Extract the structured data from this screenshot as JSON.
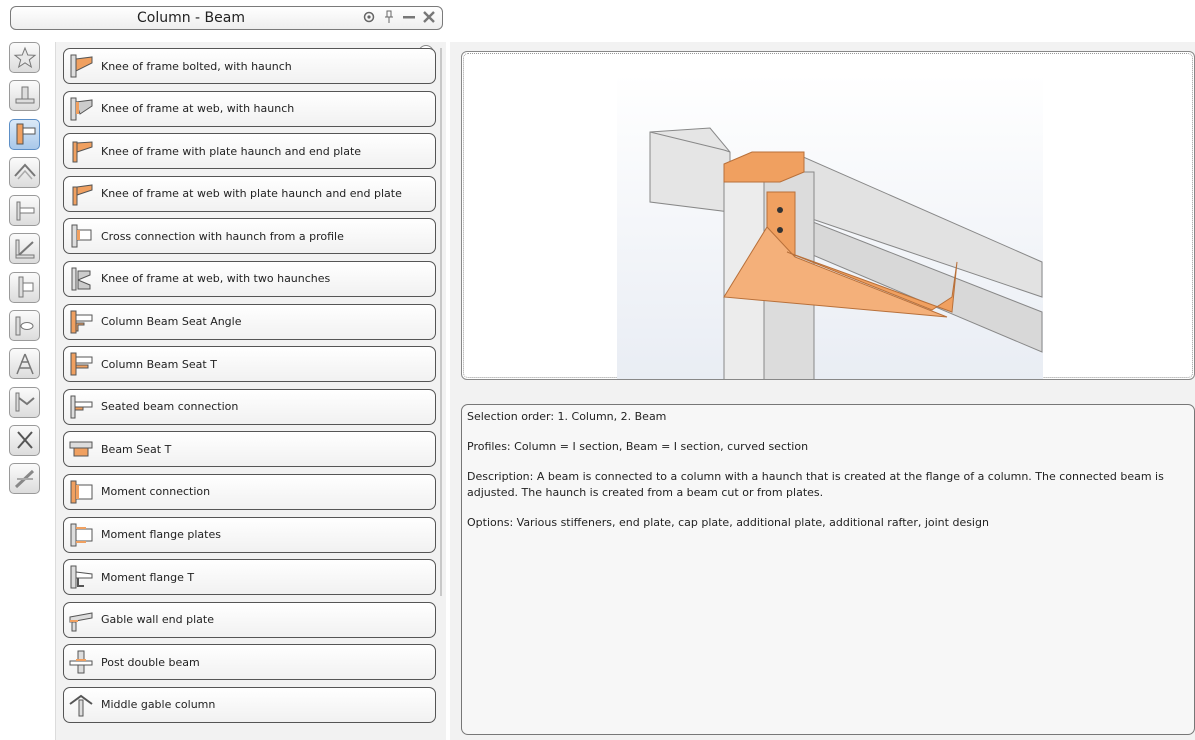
{
  "window": {
    "title": "Column - Beam"
  },
  "titlebar_icons": [
    "settings-icon",
    "pin-icon",
    "minimize-icon",
    "close-icon"
  ],
  "sidebar": {
    "buttons": [
      {
        "icon": "favorites-star-icon",
        "active": false
      },
      {
        "icon": "base-plate-icon",
        "active": false
      },
      {
        "icon": "column-beam-icon",
        "active": true
      },
      {
        "icon": "ridge-icon",
        "active": false
      },
      {
        "icon": "beam-beam-icon",
        "active": false
      },
      {
        "icon": "bracing-icon",
        "active": false
      },
      {
        "icon": "column-splice-icon",
        "active": false
      },
      {
        "icon": "pipe-connection-icon",
        "active": false
      },
      {
        "icon": "tower-icon",
        "active": false
      },
      {
        "icon": "frame-icon",
        "active": false
      },
      {
        "icon": "stairs-icon",
        "active": false
      },
      {
        "icon": "misc-icon",
        "active": false
      }
    ]
  },
  "connections": [
    {
      "label": "Knee of frame bolted, with haunch"
    },
    {
      "label": "Knee of frame at web, with haunch"
    },
    {
      "label": "Knee of frame with plate haunch and end plate"
    },
    {
      "label": "Knee of frame at web with plate haunch and end plate"
    },
    {
      "label": "Cross connection with haunch from a profile"
    },
    {
      "label": "Knee of frame at web, with two haunches"
    },
    {
      "label": "Column Beam Seat Angle"
    },
    {
      "label": "Column Beam Seat T"
    },
    {
      "label": "Seated beam connection"
    },
    {
      "label": "Beam Seat T"
    },
    {
      "label": "Moment connection"
    },
    {
      "label": "Moment flange plates"
    },
    {
      "label": "Moment flange T"
    },
    {
      "label": "Gable wall end plate"
    },
    {
      "label": "Post double beam"
    },
    {
      "label": "Middle gable column"
    }
  ],
  "details": {
    "selection_order": "Selection order: 1. Column, 2. Beam",
    "profiles": "Profiles: Column = I section, Beam = I section, curved section",
    "description": "Description: A beam is connected to a column with a haunch that is created at the flange of a column. The connected beam is adjusted. The haunch is created from a beam cut or from plates.",
    "options": "Options:  Various stiffeners, end plate, cap plate, additional plate, additional rafter, joint design"
  },
  "colors": {
    "accent_orange": "#f0a060",
    "active_blue": "#a9c8ea"
  }
}
